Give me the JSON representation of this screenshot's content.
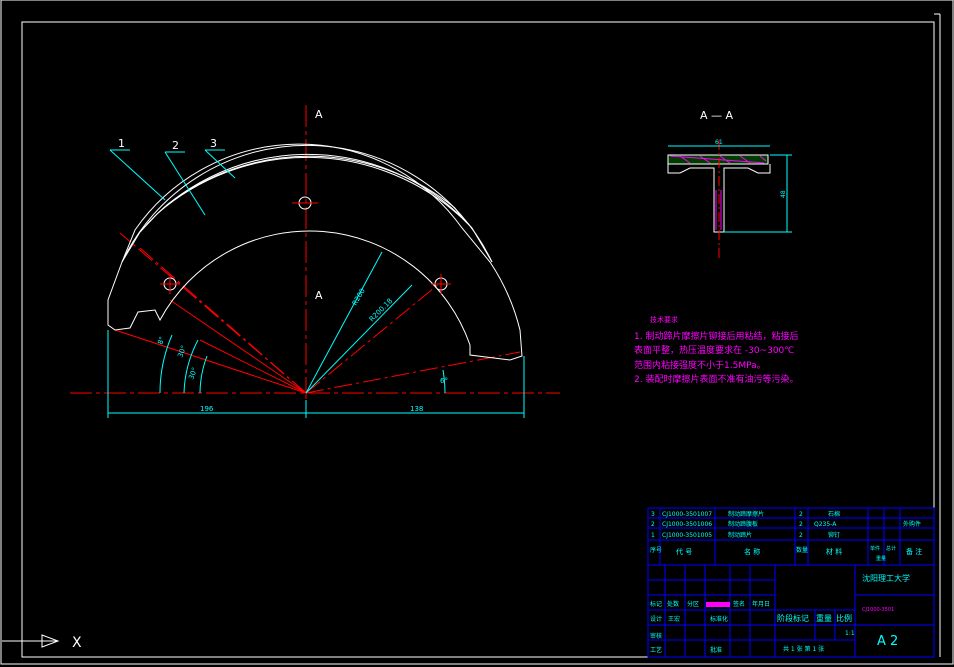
{
  "drawing": {
    "part_labels": [
      "1",
      "2",
      "3"
    ],
    "section_mark": "A",
    "section_view_title": "A — A",
    "dimensions": {
      "left_horizontal": "196",
      "right_horizontal": "138",
      "angle_a": "8°",
      "angle_b": "30°",
      "angle_c": "30°",
      "angle_d": "6°",
      "radius_inner": "R200",
      "radius_outer": "R200.18",
      "section_width": "61",
      "section_height": "48"
    },
    "tech_notes": {
      "heading": "技术要求",
      "lines": [
        "1. 制动蹄片摩擦片铆接后用粘结，粘接后",
        "   表面平整，热压温度要求在 -30~300℃",
        "   范围内粘接强度不小于1.5MPa。",
        "2. 装配时摩擦片表面不准有油污等污染。"
      ]
    },
    "axis_label": "X"
  },
  "title_block": {
    "parts": [
      {
        "no": "3",
        "code": "CJ1000-3501007",
        "name": "制动蹄摩擦片",
        "qty": "2",
        "material": "石棉",
        "note": ""
      },
      {
        "no": "2",
        "code": "CJ1000-3501006",
        "name": "制动蹄腹板",
        "qty": "2",
        "material": "Q235-A",
        "note": "外购件"
      },
      {
        "no": "1",
        "code": "CJ1000-3501005",
        "name": "制动蹄片",
        "qty": "2",
        "material": "铆钉",
        "note": ""
      }
    ],
    "header": {
      "no": "序号",
      "code": "代 号",
      "name": "名 称",
      "qty": "数量",
      "material": "材 料",
      "single": "单件",
      "total": "总计",
      "weight": "重量",
      "note": "备 注"
    },
    "school": "沈阳理工大学",
    "drawing_no": "CJ1000-3501",
    "stage_label": "阶段标记",
    "weight_label": "重量",
    "scale_label": "比例",
    "scale_value": "1:1",
    "sheet_info": "共 1 张   第 1 张",
    "sheet_size": "A 2",
    "row_labels": {
      "mark": "标记",
      "count": "处数",
      "zone": "分区",
      "change": "更改文件号",
      "sign": "签名",
      "date": "年月日",
      "design": "设计",
      "std": "标准化",
      "review": "审核",
      "process": "工艺",
      "approve": "批准"
    },
    "designer": "王宏"
  }
}
